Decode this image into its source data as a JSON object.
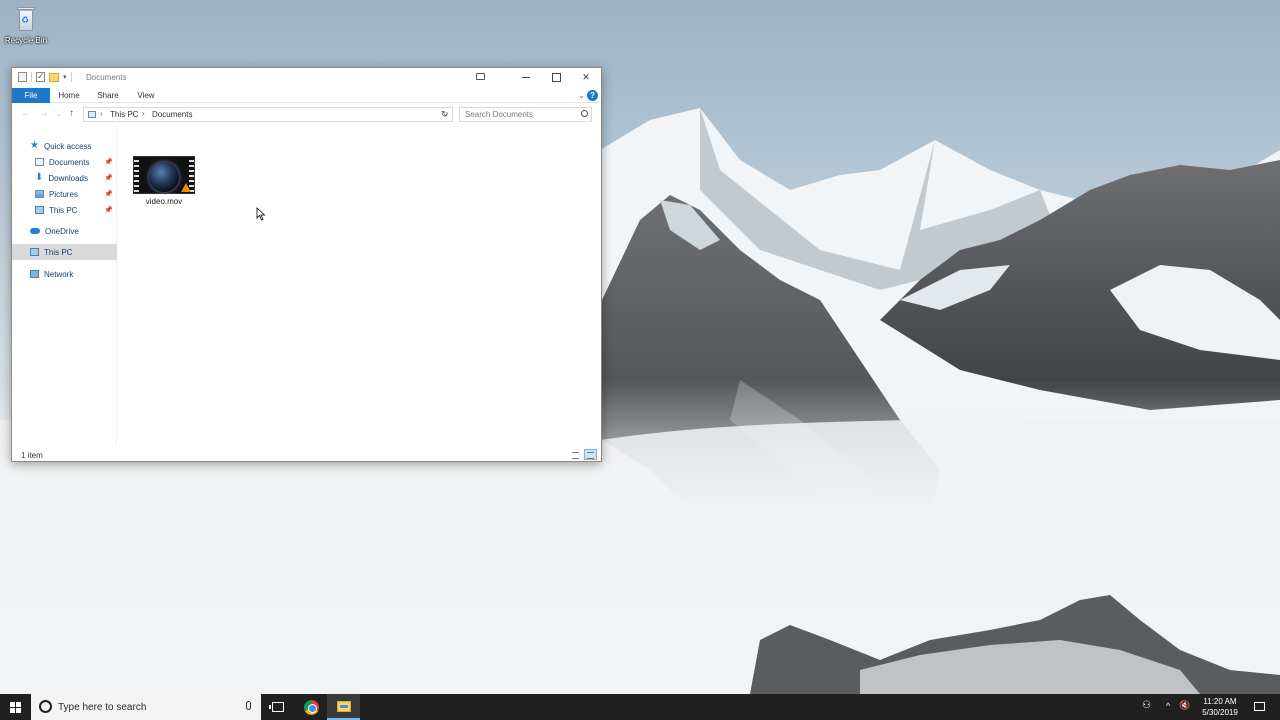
{
  "desktop": {
    "recycle_bin_label": "Recycle Bin"
  },
  "window": {
    "title": "Documents",
    "ribbon_tabs": [
      "File",
      "Home",
      "Share",
      "View"
    ],
    "breadcrumb": [
      "This PC",
      "Documents"
    ],
    "search_placeholder": "Search Documents",
    "nav_items": [
      {
        "label": "Quick access",
        "icon": "star-icon"
      },
      {
        "label": "Documents",
        "icon": "documents-icon",
        "pinned": true
      },
      {
        "label": "Downloads",
        "icon": "download-arrow-icon",
        "pinned": true
      },
      {
        "label": "Pictures",
        "icon": "pictures-icon",
        "pinned": true
      },
      {
        "label": "This PC",
        "icon": "computer-icon",
        "pinned": true
      },
      {
        "label": "OneDrive",
        "icon": "cloud-icon"
      },
      {
        "label": "This PC",
        "icon": "computer-icon",
        "selected": true
      },
      {
        "label": "Network",
        "icon": "network-icon"
      }
    ],
    "files": [
      {
        "name": "video.mov",
        "type": "video"
      }
    ],
    "status_text": "1 item",
    "colors": {
      "accent": "#1979ca",
      "selected_nav": "#d9d9d9"
    }
  },
  "taskbar": {
    "search_placeholder": "Type here to search",
    "apps": [
      "task-view",
      "chrome",
      "file-explorer"
    ],
    "active_app": "file-explorer",
    "time": "11:20 AM",
    "date": "5/30/2019",
    "background": "#202020"
  }
}
